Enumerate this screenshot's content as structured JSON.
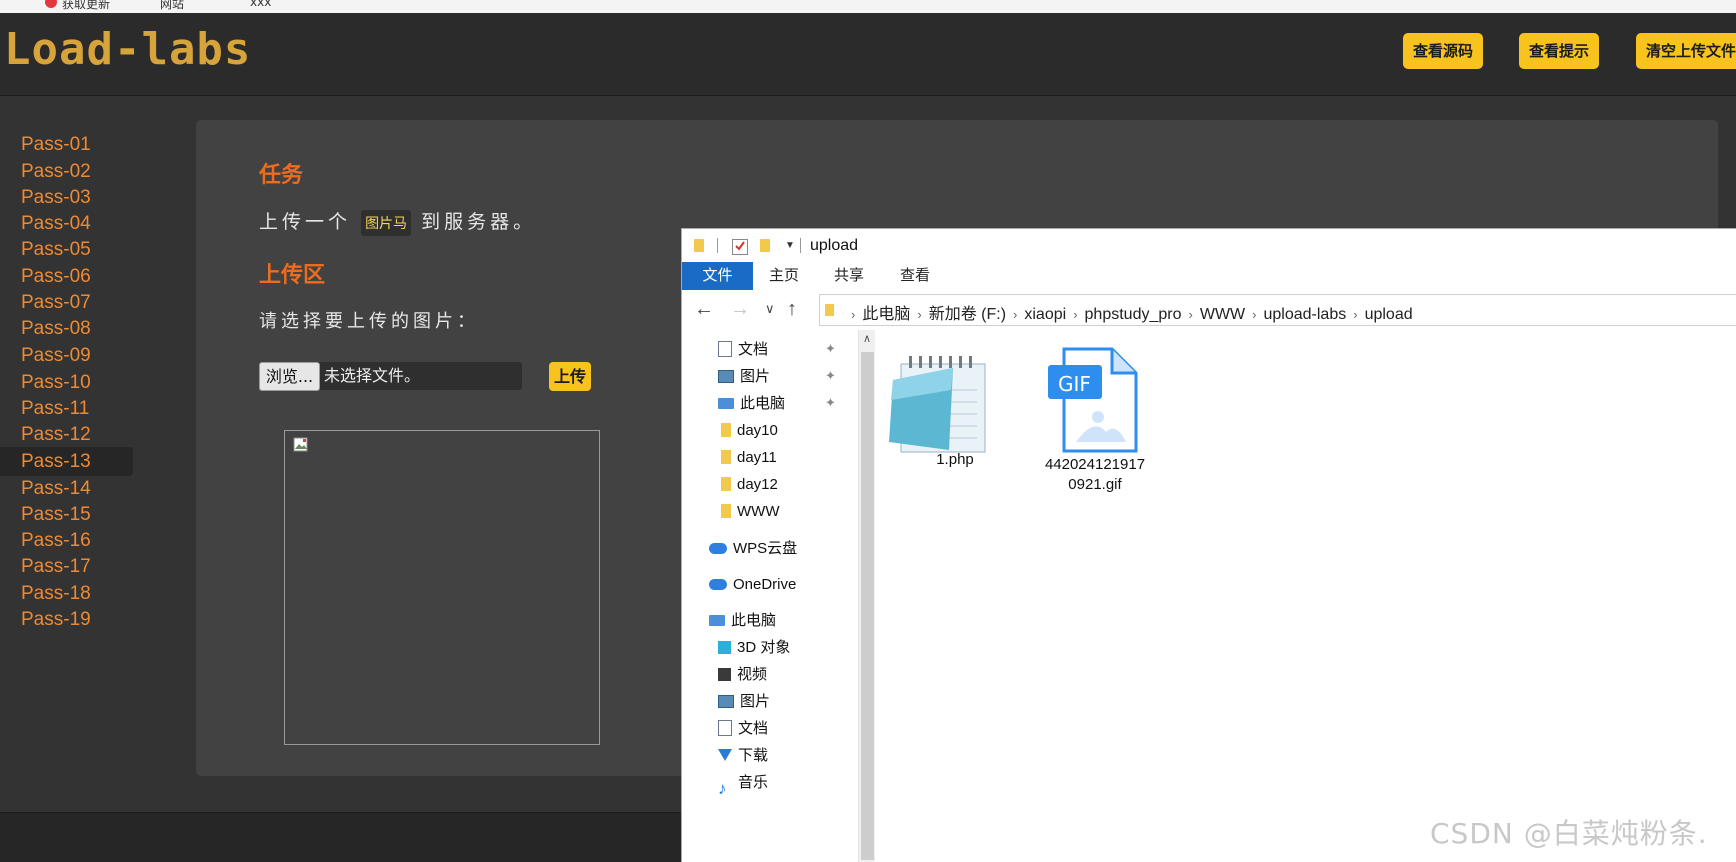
{
  "browser": {
    "items": [
      "获取更新",
      "网站",
      "xxx"
    ]
  },
  "header": {
    "logo": "Load-labs",
    "buttons": [
      {
        "label": "查看源码"
      },
      {
        "label": "查看提示"
      },
      {
        "label": "清空上传文件"
      }
    ]
  },
  "sidebar": {
    "active_index": 12,
    "items": [
      "Pass-01",
      "Pass-02",
      "Pass-03",
      "Pass-04",
      "Pass-05",
      "Pass-06",
      "Pass-07",
      "Pass-08",
      "Pass-09",
      "Pass-10",
      "Pass-11",
      "Pass-12",
      "Pass-13",
      "Pass-14",
      "Pass-15",
      "Pass-16",
      "Pass-17",
      "Pass-18",
      "Pass-19"
    ]
  },
  "main": {
    "task_heading": "任务",
    "task_prefix": "上传一个",
    "task_code": "图片马",
    "task_suffix": "到服务器。",
    "upload_heading": "上传区",
    "choose_label": "请选择要上传的图片：",
    "browse_label": "浏览...",
    "file_status": "未选择文件。",
    "upload_label": "上传"
  },
  "explorer": {
    "title": "upload",
    "ribbon_tabs": [
      "文件",
      "主页",
      "共享",
      "查看"
    ],
    "breadcrumb": [
      "此电脑",
      "新加卷 (F:)",
      "xiaopi",
      "phpstudy_pro",
      "WWW",
      "upload-labs",
      "upload"
    ],
    "nav_items": [
      {
        "label": "文档",
        "icon": "document-icon",
        "pinned": true
      },
      {
        "label": "图片",
        "icon": "pictures-icon",
        "pinned": true
      },
      {
        "label": "此电脑",
        "icon": "computer-icon",
        "pinned": true
      },
      {
        "label": "day10",
        "icon": "folder-icon",
        "pinned": false
      },
      {
        "label": "day11",
        "icon": "folder-icon",
        "pinned": false
      },
      {
        "label": "day12",
        "icon": "folder-icon",
        "pinned": false
      },
      {
        "label": "WWW",
        "icon": "folder-icon",
        "pinned": false
      },
      {
        "label": "WPS云盘",
        "icon": "cloud-icon",
        "pinned": false
      },
      {
        "label": "OneDrive",
        "icon": "cloud-icon",
        "pinned": false
      },
      {
        "label": "此电脑",
        "icon": "computer-icon",
        "pinned": false
      },
      {
        "label": "3D 对象",
        "icon": "cube-icon",
        "pinned": false
      },
      {
        "label": "视频",
        "icon": "video-icon",
        "pinned": false
      },
      {
        "label": "图片",
        "icon": "pictures-icon",
        "pinned": false
      },
      {
        "label": "文档",
        "icon": "document-icon",
        "pinned": false
      },
      {
        "label": "下载",
        "icon": "download-icon",
        "pinned": false
      },
      {
        "label": "音乐",
        "icon": "music-icon",
        "pinned": false
      }
    ],
    "files": [
      {
        "name": "1.php",
        "icon": "notepad-icon"
      },
      {
        "name_line1": "442024121917",
        "name_line2": "0921.gif",
        "icon": "gif-file-icon",
        "badge": "GIF"
      }
    ]
  },
  "watermark": "CSDN @白菜炖粉条."
}
